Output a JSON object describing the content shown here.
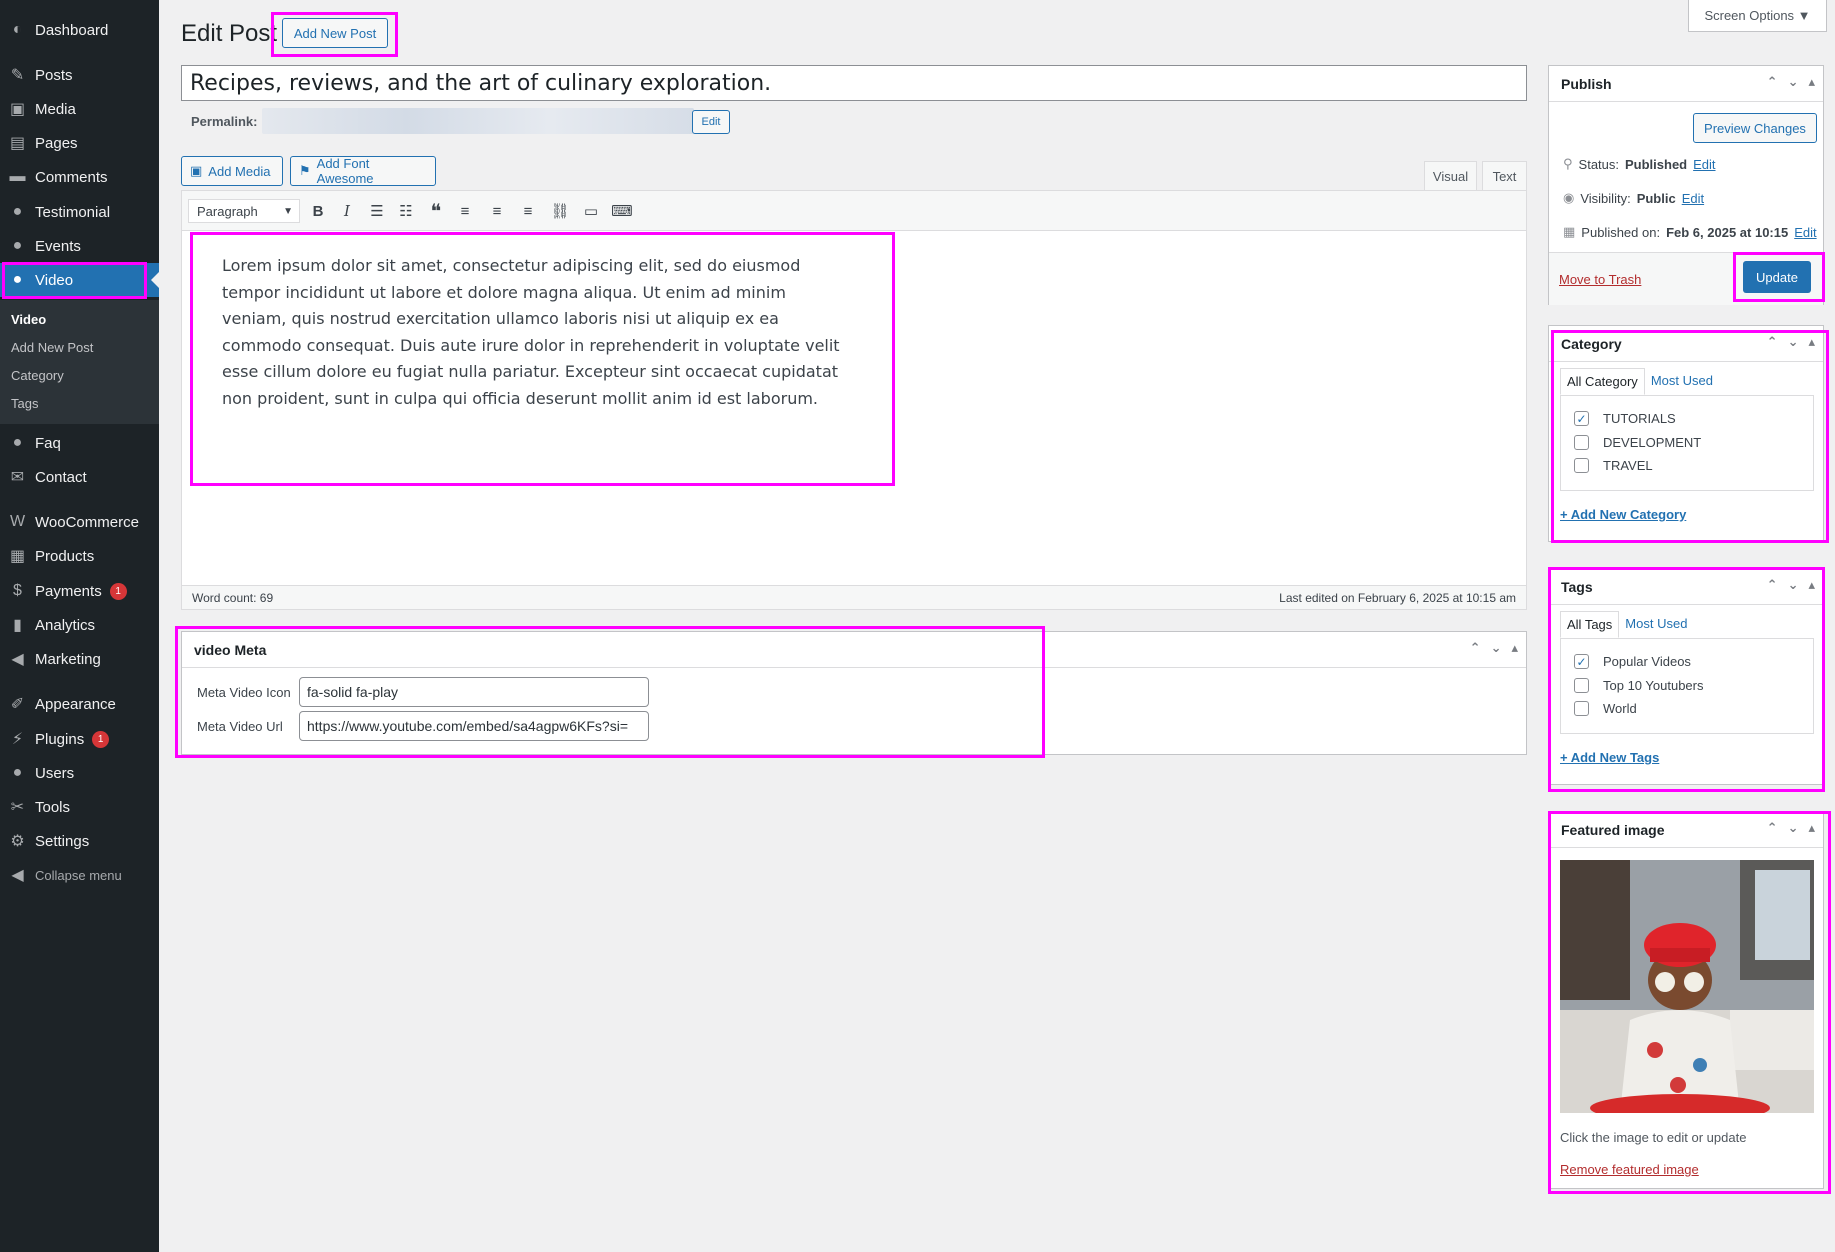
{
  "sidebar": {
    "items": [
      {
        "label": "Dashboard",
        "icon": "dashboard-icon",
        "glyph": "◐"
      },
      {
        "label": "Posts",
        "icon": "pin-icon",
        "glyph": "✎"
      },
      {
        "label": "Media",
        "icon": "media-icon",
        "glyph": "▣"
      },
      {
        "label": "Pages",
        "icon": "page-icon",
        "glyph": "▤"
      },
      {
        "label": "Comments",
        "icon": "comment-icon",
        "glyph": "▬"
      },
      {
        "label": "Testimonial",
        "icon": "user-icon",
        "glyph": "●"
      },
      {
        "label": "Events",
        "icon": "user-icon",
        "glyph": "●"
      },
      {
        "label": "Video",
        "icon": "user-icon",
        "glyph": "●"
      },
      {
        "label": "Faq",
        "icon": "user-icon",
        "glyph": "●"
      },
      {
        "label": "Contact",
        "icon": "mail-icon",
        "glyph": "✉"
      },
      {
        "label": "WooCommerce",
        "icon": "woo-icon",
        "glyph": "W"
      },
      {
        "label": "Products",
        "icon": "archive-icon",
        "glyph": "▦"
      },
      {
        "label": "Payments",
        "icon": "dollar-icon",
        "glyph": "$",
        "badge": "1"
      },
      {
        "label": "Analytics",
        "icon": "chart-icon",
        "glyph": "▮"
      },
      {
        "label": "Marketing",
        "icon": "megaphone-icon",
        "glyph": "◀"
      },
      {
        "label": "Appearance",
        "icon": "brush-icon",
        "glyph": "✐"
      },
      {
        "label": "Plugins",
        "icon": "plug-icon",
        "glyph": "⚡",
        "badge": "1"
      },
      {
        "label": "Users",
        "icon": "user-icon",
        "glyph": "●"
      },
      {
        "label": "Tools",
        "icon": "wrench-icon",
        "glyph": "✂"
      },
      {
        "label": "Settings",
        "icon": "settings-icon",
        "glyph": "⚙"
      },
      {
        "label": "Collapse menu",
        "icon": "collapse-icon",
        "glyph": "◀"
      }
    ],
    "submenu": [
      "Video",
      "Add New Post",
      "Category",
      "Tags"
    ]
  },
  "header": {
    "title": "Edit Post",
    "add_new": "Add New Post",
    "screen_options": "Screen Options ▼"
  },
  "post": {
    "title": "Recipes, reviews, and the art of culinary exploration.",
    "permalink_label": "Permalink:",
    "permalink_edit": "Edit",
    "add_media": "Add Media",
    "add_font_awesome": "Add Font Awesome",
    "tab_visual": "Visual",
    "tab_text": "Text",
    "format": "Paragraph",
    "content": "Lorem ipsum dolor sit amet, consectetur adipiscing elit, sed do eiusmod tempor incididunt ut labore et dolore magna aliqua. Ut enim ad minim veniam, quis nostrud exercitation ullamco laboris nisi ut aliquip ex ea commodo consequat. Duis aute irure dolor in reprehenderit in voluptate velit esse cillum dolore eu fugiat nulla pariatur. Excepteur sint occaecat cupidatat non proident, sunt in culpa qui officia deserunt mollit anim id est laborum.",
    "word_count": "Word count: 69",
    "last_edited": "Last edited on February 6, 2025 at 10:15 am"
  },
  "video_meta": {
    "title": "video Meta",
    "icon_label": "Meta Video Icon",
    "icon_value": "fa-solid fa-play",
    "url_label": "Meta Video Url",
    "url_value": "https://www.youtube.com/embed/sa4agpw6KFs?si="
  },
  "publish": {
    "title": "Publish",
    "preview": "Preview Changes",
    "status_label": "Status:",
    "status_value": "Published",
    "visibility_label": "Visibility:",
    "visibility_value": "Public",
    "published_label": "Published on:",
    "published_value": "Feb 6, 2025 at 10:15",
    "edit": "Edit",
    "trash": "Move to Trash",
    "update": "Update"
  },
  "category": {
    "title": "Category",
    "tab_all": "All Category",
    "tab_most": "Most Used",
    "items": [
      {
        "label": "TUTORIALS",
        "checked": true
      },
      {
        "label": "DEVELOPMENT",
        "checked": false
      },
      {
        "label": "TRAVEL",
        "checked": false
      }
    ],
    "add_new": "+ Add New Category"
  },
  "tags": {
    "title": "Tags",
    "tab_all": "All Tags",
    "tab_most": "Most Used",
    "items": [
      {
        "label": "Popular Videos",
        "checked": true
      },
      {
        "label": "Top 10 Youtubers",
        "checked": false
      },
      {
        "label": "World",
        "checked": false
      }
    ],
    "add_new": "+ Add New Tags"
  },
  "featured": {
    "title": "Featured image",
    "hint": "Click the image to edit or update",
    "remove": "Remove featured image"
  },
  "colors": {
    "accent": "#2271b1",
    "highlight": "#ff00ff",
    "sidebar": "#1d2327",
    "danger": "#b32d2e"
  }
}
